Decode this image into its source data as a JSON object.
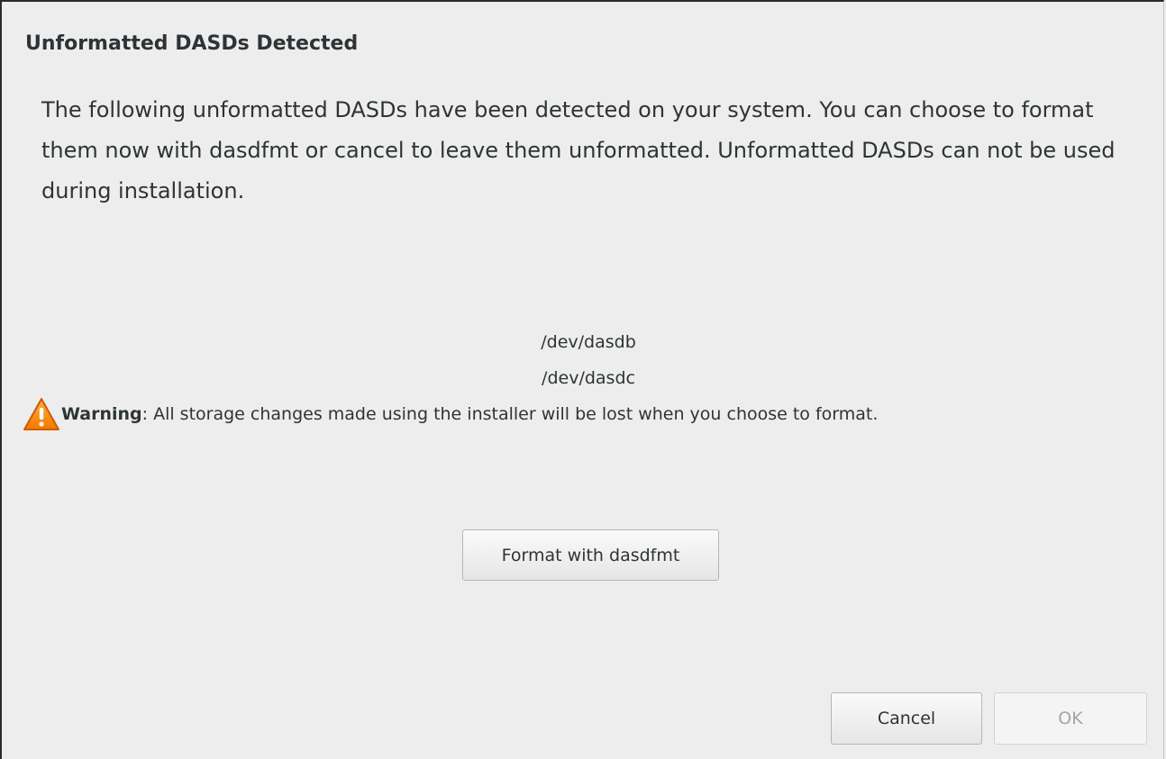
{
  "dialog": {
    "title": "Unformatted DASDs Detected",
    "description": "The following unformatted DASDs have been detected on your system. You can choose to format them now with dasdfmt or cancel to leave them unformatted. Unformatted DASDs can not be used during installation.",
    "devices": [
      "/dev/dasdb",
      "/dev/dasdc"
    ],
    "warning": {
      "icon": "warning-triangle-icon",
      "label": "Warning",
      "separator": ":",
      "message": " All storage changes made using the installer will be lost when you choose to format."
    },
    "format_button_label": "Format with dasdfmt",
    "cancel_button_label": "Cancel",
    "ok_button_label": "OK",
    "ok_button_enabled": false
  },
  "colors": {
    "background": "#ededed",
    "text": "#2e3436",
    "warning_orange": "#f57900",
    "disabled_text": "#a4a6a3"
  }
}
